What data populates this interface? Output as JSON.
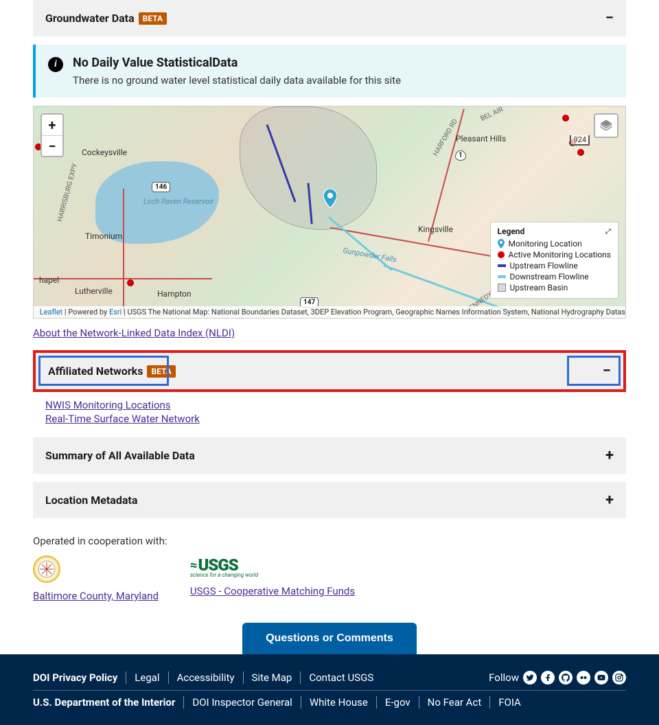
{
  "accordion1": {
    "title": "Groundwater Data",
    "badge": "BETA",
    "toggle": "−"
  },
  "info": {
    "title": "No Daily Value StatisticalData",
    "text": "There is no ground water level statistical daily data available for this site"
  },
  "map": {
    "zoom_in": "+",
    "zoom_out": "−",
    "scale": "924",
    "labels": {
      "cockeysville": "Cockeysville",
      "timonium": "Timonium",
      "lutherville": "Lutherville",
      "hampton": "Hampton",
      "loch_raven": "Loch Raven Reservoir",
      "kingsville": "Kingsville",
      "pleasant_hills": "Pleasant Hills",
      "belair": "BEL AIR",
      "hapel": "hapel",
      "gunpowder": "Gunpowder Falls",
      "route146": "146",
      "route147": "147",
      "route1": "1",
      "harford": "HARFORD RD",
      "harrisburg": "HARRISBURG EXPY",
      "kennedy": "KENNEDY MEMORIAL HWY"
    },
    "legend": {
      "title": "Legend",
      "items": [
        {
          "label": "Monitoring Location",
          "type": "pin",
          "color": "#2ea3d6"
        },
        {
          "label": "Active Monitoring Locations",
          "type": "dot",
          "color": "#d00"
        },
        {
          "label": "Upstream Flowline",
          "type": "line",
          "color": "#3239a8"
        },
        {
          "label": "Downstream Flowline",
          "type": "line",
          "color": "#6fcce0"
        },
        {
          "label": "Upstream Basin",
          "type": "box",
          "color": "rgba(180,180,180,0.5)"
        }
      ]
    },
    "attribution_leaflet": "Leaflet",
    "attribution_powered": " | Powered by ",
    "attribution_esri": "Esri",
    "attribution_rest": " | USGS The National Map: National Boundaries Dataset, 3DEP Elevation Program, Geographic Names Information System, National Hydrography Dataset, Natio"
  },
  "about_nldi": "About the Network-Linked Data Index (NLDI)",
  "affiliated": {
    "title": "Affiliated Networks",
    "badge": "BETA",
    "toggle": "−",
    "links": [
      "NWIS Monitoring Locations",
      "Real-Time Surface Water Network"
    ]
  },
  "accordion_summary": {
    "title": "Summary of All Available Data",
    "toggle": "+"
  },
  "accordion_metadata": {
    "title": "Location Metadata",
    "toggle": "+"
  },
  "cooperation": {
    "intro": "Operated in cooperation with:",
    "items": [
      {
        "label": "Baltimore County, Maryland"
      },
      {
        "label": "USGS - Cooperative Matching Funds"
      }
    ],
    "usgs_name": "USGS",
    "usgs_tag": "science for a changing world"
  },
  "questions_btn": "Questions or Comments",
  "footer": {
    "row1": [
      "DOI Privacy Policy",
      "Legal",
      "Accessibility",
      "Site Map",
      "Contact USGS"
    ],
    "follow": "Follow",
    "row2": [
      "U.S. Department of the Interior",
      "DOI Inspector General",
      "White House",
      "E-gov",
      "No Fear Act",
      "FOIA"
    ]
  }
}
